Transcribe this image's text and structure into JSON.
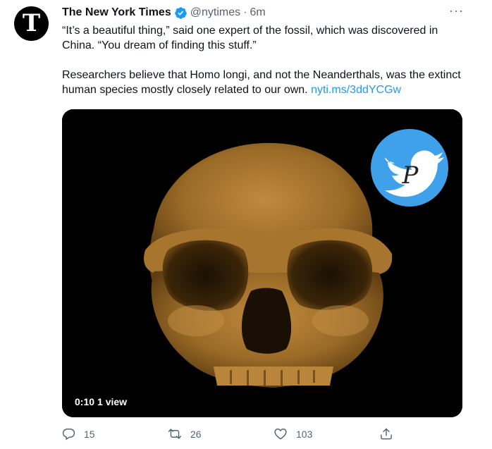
{
  "author": {
    "avatar_glyph": "T",
    "name": "The New York Times",
    "handle": "@nytimes",
    "separator": "·",
    "time": "6m",
    "verified_icon": "verified-badge-icon"
  },
  "more_label": "···",
  "text": {
    "paragraph1": "“It’s a beautiful thing,” said one expert of the fossil, which was discovered in China. “You dream of finding this stuff.”",
    "paragraph2": "Researchers believe that Homo longi, and not the Neanderthals, was the extinct human species mostly closely related to our own.",
    "link": "nyti.ms/3ddYCGw"
  },
  "media": {
    "duration": "0:10",
    "views": "1 view",
    "badge_letter": "P"
  },
  "actions": {
    "replies": "15",
    "retweets": "26",
    "likes": "103"
  },
  "colors": {
    "accent": "#1d9bf0",
    "muted": "#536471",
    "skull": "#a3712b"
  }
}
